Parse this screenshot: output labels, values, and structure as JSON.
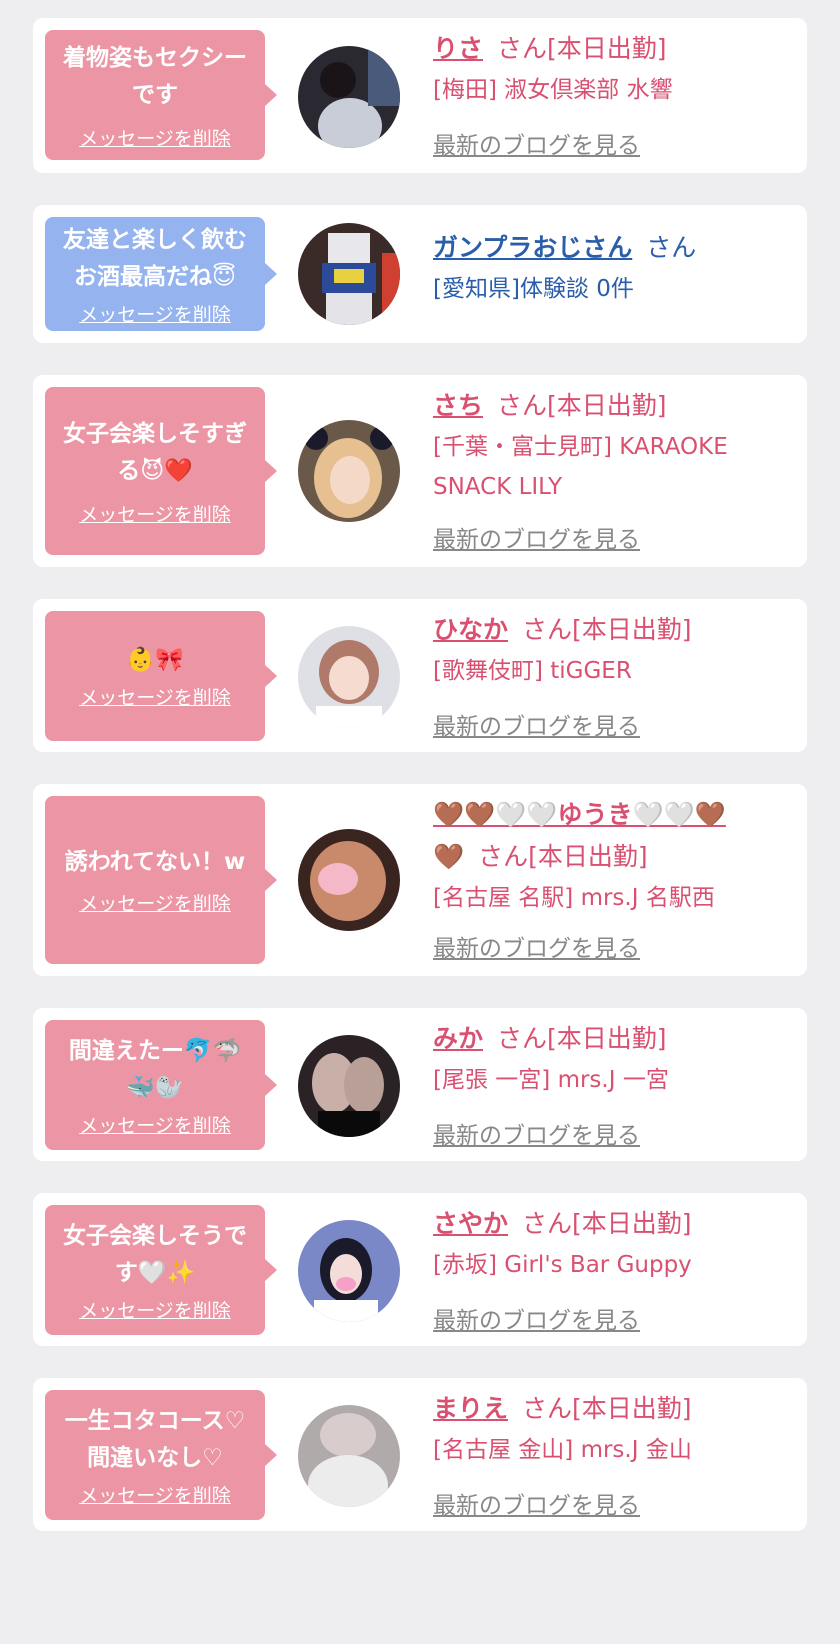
{
  "colors": {
    "pink_bubble": "#ec96a5",
    "blue_bubble": "#95b3ee",
    "pink_text": "#d95070",
    "blue_text": "#2a5eaa",
    "blog_gray": "#888888"
  },
  "delete_label": "メッセージを削除",
  "blog_label": "最新のブログを見る",
  "items": [
    {
      "msg_lines": [
        "着物姿もセクシー",
        "です"
      ],
      "name": "りさ",
      "suffix": "さん[本日出勤]",
      "shop": "[梅田] 淑女倶楽部 水響"
    },
    {
      "msg_lines": [
        "友達と楽しく飲む",
        "お酒最高だね😇"
      ],
      "name": "ガンプラおじさん",
      "suffix": "さん",
      "shop": "[愛知県]体験談 0件"
    },
    {
      "msg_lines": [
        "女子会楽しそすぎ",
        "る😈❤️"
      ],
      "name": "さち",
      "suffix": "さん[本日出勤]",
      "shop": "[千葉・富士見町] KARAOKE SNACK LILY"
    },
    {
      "msg_lines": [
        "👶🎀"
      ],
      "name": "ひなか",
      "suffix": "さん[本日出勤]",
      "shop": "[歌舞伎町] tiGGER"
    },
    {
      "msg_lines": [
        "誘われてない！w"
      ],
      "name": "🤎🤎🤍🤍ゆうき🤍🤍🤎",
      "name_line2": "🤎",
      "suffix": "さん[本日出勤]",
      "shop": "[名古屋 名駅] mrs.J 名駅西"
    },
    {
      "msg_lines": [
        "間違えたー🐬🦈",
        "🐳🦭"
      ],
      "name": "みか",
      "suffix": "さん[本日出勤]",
      "shop": "[尾張 一宮] mrs.J 一宮"
    },
    {
      "msg_lines": [
        "女子会楽しそうで",
        "す🤍✨"
      ],
      "name": "さやか",
      "suffix": "さん[本日出勤]",
      "shop": "[赤坂] Girl's Bar Guppy"
    },
    {
      "msg_lines": [
        "一生コタコース♡",
        "間違いなし♡"
      ],
      "name": "まりえ",
      "suffix": "さん[本日出勤]",
      "shop": "[名古屋 金山] mrs.J 金山"
    }
  ]
}
